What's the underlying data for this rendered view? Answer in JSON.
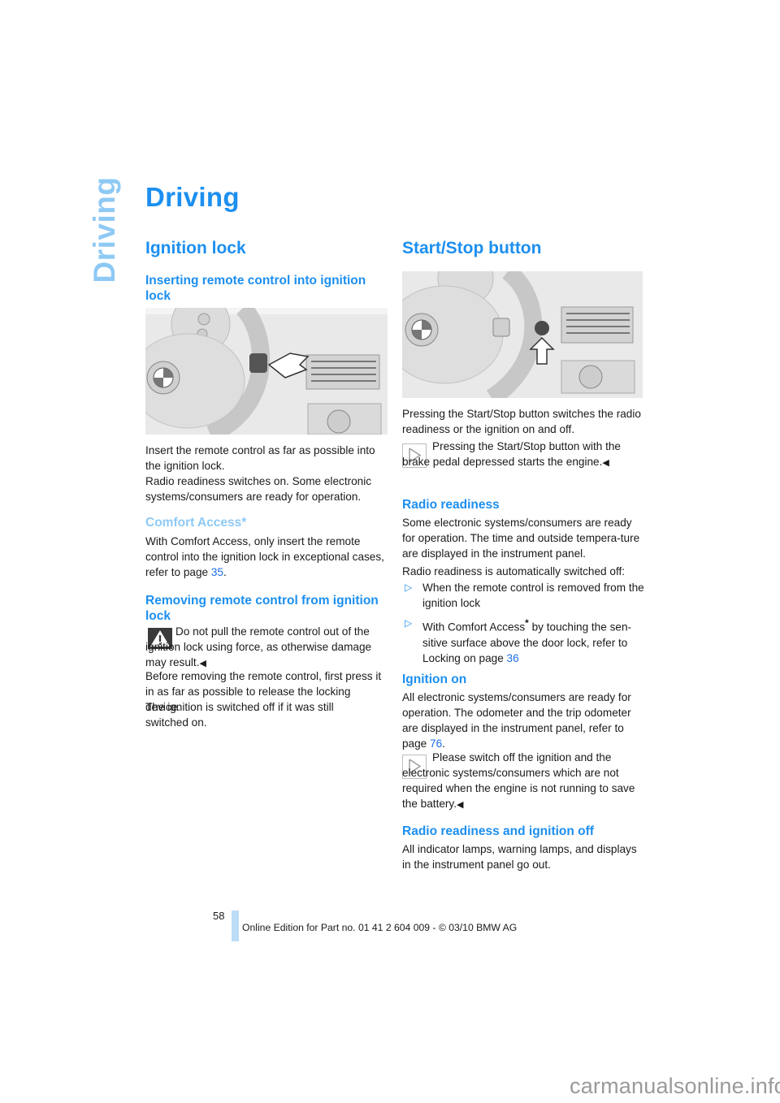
{
  "side_tab": "Driving",
  "page_title": "Driving",
  "left": {
    "heading": "Ignition lock",
    "insert": {
      "subheading": "Inserting remote control into ignition lock",
      "figure_label": "steering-wheel-ignition-lock-illustration",
      "p1": "Insert the remote control as far as possible into the ignition lock.",
      "p2": "Radio readiness switches on. Some electronic systems/consumers are ready for operation."
    },
    "comfort": {
      "subheading": "Comfort Access*",
      "text_before": "With Comfort Access, only insert the remote control into the ignition lock in exceptional cases, refer to page ",
      "link": "35",
      "text_after": "."
    },
    "removing": {
      "subheading": "Removing remote control from ignition lock",
      "warning": "Do not pull the remote control out of the ignition lock using force, as otherwise damage may result.",
      "end_mark": "◀",
      "p1": "Before removing the remote control, first press it in as far as possible to release the locking device.",
      "p2": "The ignition is switched off if it was still switched on."
    }
  },
  "right": {
    "heading": "Start/Stop button",
    "figure_label": "steering-wheel-start-stop-illustration",
    "intro": "Pressing the Start/Stop button switches the radio readiness or the ignition on and off.",
    "note1": "Pressing the Start/Stop button with the brake pedal depressed starts the engine.",
    "end_mark": "◀",
    "radio": {
      "subheading": "Radio readiness",
      "p1": "Some electronic systems/consumers are ready for operation. The time and outside tempera-ture are displayed in the instrument panel.",
      "p2": "Radio readiness is automatically switched off:",
      "bullets": [
        {
          "text": "When the remote control is removed from the ignition lock"
        },
        {
          "text_before": "With Comfort Access",
          "star": "*",
          "text_mid": " by touching the sen-sitive surface above the door lock, refer to Locking on page ",
          "link": "36"
        }
      ],
      "bullet_marker": "▷"
    },
    "ignition_on": {
      "subheading": "Ignition on",
      "text_before": "All electronic systems/consumers are ready for operation. The odometer and the trip odometer are displayed in the instrument panel, refer to page ",
      "link": "76",
      "text_after": ".",
      "note": "Please switch off the ignition and the electronic systems/consumers which are not required when the engine is not running to save the battery."
    },
    "off": {
      "subheading": "Radio readiness and ignition off",
      "p1": "All indicator lamps, warning lamps, and displays in the instrument panel go out."
    }
  },
  "footer": {
    "page_number": "58",
    "edition": "Online Edition for Part no. 01 41 2 604 009 - © 03/10 BMW AG"
  },
  "watermark": "carmanualsonline.info",
  "colors": {
    "heading_blue": "#1c8ff0",
    "light_blue": "#8ec9f5",
    "link_blue": "#1c6fe6",
    "footer_bar": "#bcdcf7"
  }
}
